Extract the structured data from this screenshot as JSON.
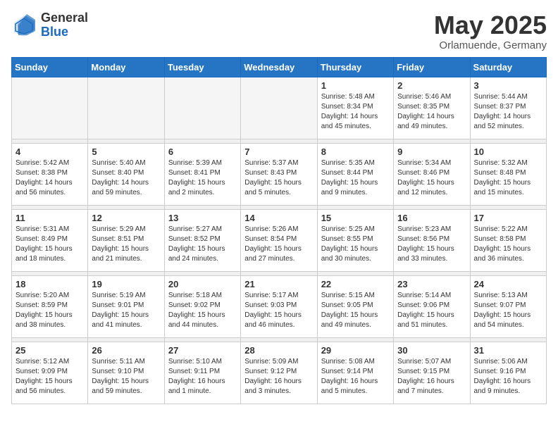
{
  "header": {
    "logo_general": "General",
    "logo_blue": "Blue",
    "title": "May 2025",
    "subtitle": "Orlamuende, Germany"
  },
  "days_of_week": [
    "Sunday",
    "Monday",
    "Tuesday",
    "Wednesday",
    "Thursday",
    "Friday",
    "Saturday"
  ],
  "weeks": [
    [
      {
        "day": "",
        "info": ""
      },
      {
        "day": "",
        "info": ""
      },
      {
        "day": "",
        "info": ""
      },
      {
        "day": "",
        "info": ""
      },
      {
        "day": "1",
        "info": "Sunrise: 5:48 AM\nSunset: 8:34 PM\nDaylight: 14 hours\nand 45 minutes."
      },
      {
        "day": "2",
        "info": "Sunrise: 5:46 AM\nSunset: 8:35 PM\nDaylight: 14 hours\nand 49 minutes."
      },
      {
        "day": "3",
        "info": "Sunrise: 5:44 AM\nSunset: 8:37 PM\nDaylight: 14 hours\nand 52 minutes."
      }
    ],
    [
      {
        "day": "4",
        "info": "Sunrise: 5:42 AM\nSunset: 8:38 PM\nDaylight: 14 hours\nand 56 minutes."
      },
      {
        "day": "5",
        "info": "Sunrise: 5:40 AM\nSunset: 8:40 PM\nDaylight: 14 hours\nand 59 minutes."
      },
      {
        "day": "6",
        "info": "Sunrise: 5:39 AM\nSunset: 8:41 PM\nDaylight: 15 hours\nand 2 minutes."
      },
      {
        "day": "7",
        "info": "Sunrise: 5:37 AM\nSunset: 8:43 PM\nDaylight: 15 hours\nand 5 minutes."
      },
      {
        "day": "8",
        "info": "Sunrise: 5:35 AM\nSunset: 8:44 PM\nDaylight: 15 hours\nand 9 minutes."
      },
      {
        "day": "9",
        "info": "Sunrise: 5:34 AM\nSunset: 8:46 PM\nDaylight: 15 hours\nand 12 minutes."
      },
      {
        "day": "10",
        "info": "Sunrise: 5:32 AM\nSunset: 8:48 PM\nDaylight: 15 hours\nand 15 minutes."
      }
    ],
    [
      {
        "day": "11",
        "info": "Sunrise: 5:31 AM\nSunset: 8:49 PM\nDaylight: 15 hours\nand 18 minutes."
      },
      {
        "day": "12",
        "info": "Sunrise: 5:29 AM\nSunset: 8:51 PM\nDaylight: 15 hours\nand 21 minutes."
      },
      {
        "day": "13",
        "info": "Sunrise: 5:27 AM\nSunset: 8:52 PM\nDaylight: 15 hours\nand 24 minutes."
      },
      {
        "day": "14",
        "info": "Sunrise: 5:26 AM\nSunset: 8:54 PM\nDaylight: 15 hours\nand 27 minutes."
      },
      {
        "day": "15",
        "info": "Sunrise: 5:25 AM\nSunset: 8:55 PM\nDaylight: 15 hours\nand 30 minutes."
      },
      {
        "day": "16",
        "info": "Sunrise: 5:23 AM\nSunset: 8:56 PM\nDaylight: 15 hours\nand 33 minutes."
      },
      {
        "day": "17",
        "info": "Sunrise: 5:22 AM\nSunset: 8:58 PM\nDaylight: 15 hours\nand 36 minutes."
      }
    ],
    [
      {
        "day": "18",
        "info": "Sunrise: 5:20 AM\nSunset: 8:59 PM\nDaylight: 15 hours\nand 38 minutes."
      },
      {
        "day": "19",
        "info": "Sunrise: 5:19 AM\nSunset: 9:01 PM\nDaylight: 15 hours\nand 41 minutes."
      },
      {
        "day": "20",
        "info": "Sunrise: 5:18 AM\nSunset: 9:02 PM\nDaylight: 15 hours\nand 44 minutes."
      },
      {
        "day": "21",
        "info": "Sunrise: 5:17 AM\nSunset: 9:03 PM\nDaylight: 15 hours\nand 46 minutes."
      },
      {
        "day": "22",
        "info": "Sunrise: 5:15 AM\nSunset: 9:05 PM\nDaylight: 15 hours\nand 49 minutes."
      },
      {
        "day": "23",
        "info": "Sunrise: 5:14 AM\nSunset: 9:06 PM\nDaylight: 15 hours\nand 51 minutes."
      },
      {
        "day": "24",
        "info": "Sunrise: 5:13 AM\nSunset: 9:07 PM\nDaylight: 15 hours\nand 54 minutes."
      }
    ],
    [
      {
        "day": "25",
        "info": "Sunrise: 5:12 AM\nSunset: 9:09 PM\nDaylight: 15 hours\nand 56 minutes."
      },
      {
        "day": "26",
        "info": "Sunrise: 5:11 AM\nSunset: 9:10 PM\nDaylight: 15 hours\nand 59 minutes."
      },
      {
        "day": "27",
        "info": "Sunrise: 5:10 AM\nSunset: 9:11 PM\nDaylight: 16 hours\nand 1 minute."
      },
      {
        "day": "28",
        "info": "Sunrise: 5:09 AM\nSunset: 9:12 PM\nDaylight: 16 hours\nand 3 minutes."
      },
      {
        "day": "29",
        "info": "Sunrise: 5:08 AM\nSunset: 9:14 PM\nDaylight: 16 hours\nand 5 minutes."
      },
      {
        "day": "30",
        "info": "Sunrise: 5:07 AM\nSunset: 9:15 PM\nDaylight: 16 hours\nand 7 minutes."
      },
      {
        "day": "31",
        "info": "Sunrise: 5:06 AM\nSunset: 9:16 PM\nDaylight: 16 hours\nand 9 minutes."
      }
    ]
  ]
}
